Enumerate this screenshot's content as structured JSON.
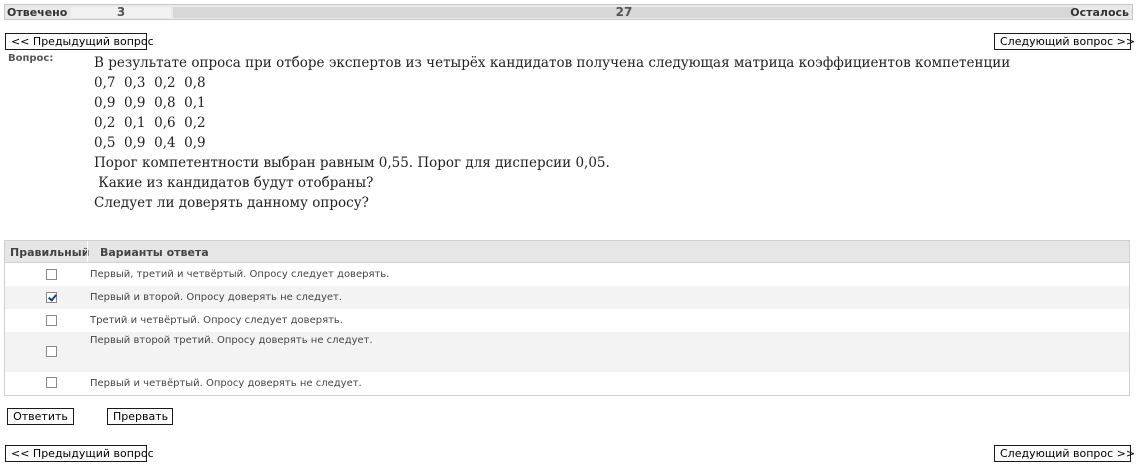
{
  "progress": {
    "answered_label": "Отвечено",
    "answered_count": "3",
    "remaining_count": "27",
    "remaining_label": "Осталось",
    "answered_fraction": 0.1
  },
  "nav": {
    "prev_label": "<< Предыдущий вопрос",
    "next_label": "Следующий вопрос >>"
  },
  "question": {
    "label": "Вопрос:",
    "lines": [
      "В результате опроса при отборе экспертов из четырёх кандидатов получена следующая матрица коэффициентов компетенции",
      "0,7  0,3  0,2  0,8",
      "0,9  0,9  0,8  0,1",
      "0,2  0,1  0,6  0,2",
      "0,5  0,9  0,4  0,9",
      "Порог компетентности выбран равным 0,55. Порог для дисперсии 0,05.",
      " Какие из кандидатов будут отобраны?",
      "Следует ли доверять данному опросу?"
    ]
  },
  "answers": {
    "col_correct": "Правильный",
    "col_options": "Варианты ответа",
    "options": [
      {
        "text": "Первый, третий и четвёртый. Опросу следует доверять.",
        "checked": false
      },
      {
        "text": "Первый и второй. Опросу доверять не следует.",
        "checked": true
      },
      {
        "text": "Третий и четвёртый. Опросу следует доверять.",
        "checked": false
      },
      {
        "text": "Первый второй третий. Опросу доверять не следует.",
        "checked": false
      },
      {
        "text": "Первый и четвёртый. Опросу доверять не следует.",
        "checked": false
      }
    ]
  },
  "actions": {
    "answer_label": "Ответить",
    "abort_label": "Прервать"
  }
}
